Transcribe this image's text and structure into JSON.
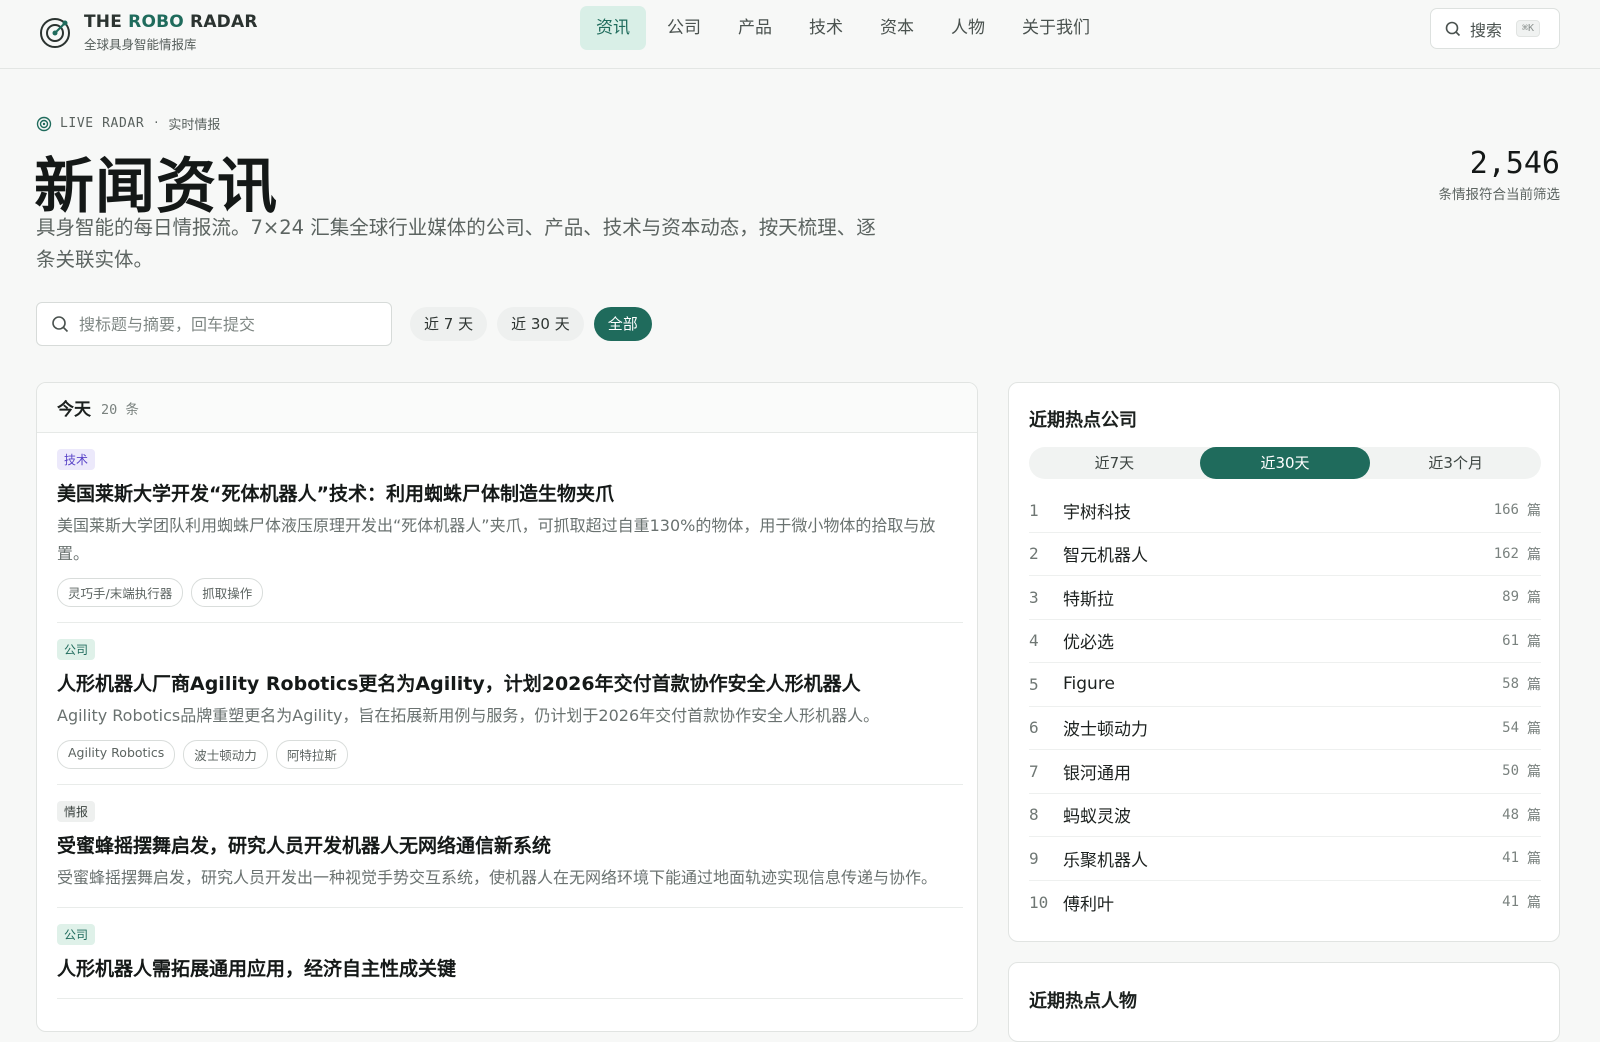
{
  "brand": {
    "title_part1": "THE ",
    "title_accent": "ROBO",
    "title_part2": " RADAR",
    "subtitle": "全球具身智能情报库"
  },
  "nav": {
    "items": [
      "资讯",
      "公司",
      "产品",
      "技术",
      "资本",
      "人物",
      "关于我们"
    ],
    "active_index": 0
  },
  "search": {
    "label": "搜索",
    "shortcut": "⌘K"
  },
  "hero": {
    "eyebrow_en": "LIVE RADAR",
    "eyebrow_sep": "·",
    "eyebrow_cn": "实时情报",
    "title": "新闻资讯",
    "description": "具身智能的每日情报流。7×24 汇集全球行业媒体的公司、产品、技术与资本动态，按天梳理、逐条关联实体。",
    "count": "2,546",
    "count_label": "条情报符合当前筛选"
  },
  "filters": {
    "search_placeholder": "搜标题与摘要，回车提交",
    "ranges": [
      "近 7 天",
      "近 30 天",
      "全部"
    ],
    "active_index": 2
  },
  "news": {
    "group_label": "今天",
    "group_count": "20 条",
    "items": [
      {
        "badge": "技术",
        "title": "美国莱斯大学开发“死体机器人”技术：利用蜘蛛尸体制造生物夹爪",
        "summary": "美国莱斯大学团队利用蜘蛛尸体液压原理开发出“死体机器人”夹爪，可抓取超过自重130%的物体，用于微小物体的拾取与放置。",
        "tags": [
          "灵巧手/末端执行器",
          "抓取操作"
        ]
      },
      {
        "badge": "公司",
        "title": "人形机器人厂商Agility Robotics更名为Agility，计划2026年交付首款协作安全人形机器人",
        "summary": "Agility Robotics品牌重塑更名为Agility，旨在拓展新用例与服务，仍计划于2026年交付首款协作安全人形机器人。",
        "tags": [
          "Agility Robotics",
          "波士顿动力",
          "阿特拉斯"
        ]
      },
      {
        "badge": "情报",
        "title": "受蜜蜂摇摆舞启发，研究人员开发机器人无网络通信新系统",
        "summary": "受蜜蜂摇摆舞启发，研究人员开发出一种视觉手势交互系统，使机器人在无网络环境下能通过地面轨迹实现信息传递与协作。",
        "tags": []
      },
      {
        "badge": "公司",
        "title": "人形机器人需拓展通用应用，经济自主性成关键",
        "summary": "",
        "tags": []
      }
    ]
  },
  "hot_companies": {
    "title": "近期热点公司",
    "ranges": [
      "近7天",
      "近30天",
      "近3个月"
    ],
    "active_index": 1,
    "unit": "篇",
    "rows": [
      {
        "rank": "1",
        "name": "宇树科技",
        "count": "166"
      },
      {
        "rank": "2",
        "name": "智元机器人",
        "count": "162"
      },
      {
        "rank": "3",
        "name": "特斯拉",
        "count": "89"
      },
      {
        "rank": "4",
        "name": "优必选",
        "count": "61"
      },
      {
        "rank": "5",
        "name": "Figure",
        "count": "58"
      },
      {
        "rank": "6",
        "name": "波士顿动力",
        "count": "54"
      },
      {
        "rank": "7",
        "name": "银河通用",
        "count": "50"
      },
      {
        "rank": "8",
        "name": "蚂蚁灵波",
        "count": "48"
      },
      {
        "rank": "9",
        "name": "乐聚机器人",
        "count": "41"
      },
      {
        "rank": "10",
        "name": "傅利叶",
        "count": "41"
      }
    ]
  },
  "hot_people": {
    "title": "近期热点人物"
  },
  "colors": {
    "accent": "#1f6b5c",
    "accent_light": "#d9efe7",
    "tech_badge": "#5a45c8"
  }
}
